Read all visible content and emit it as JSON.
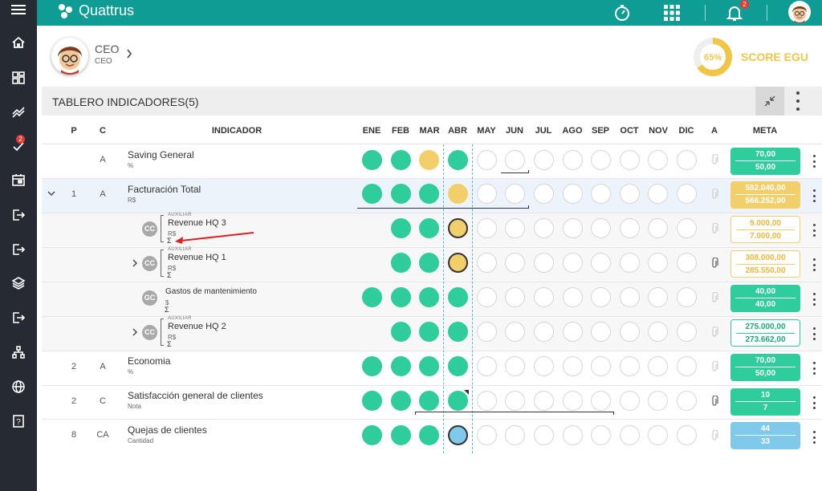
{
  "app": {
    "brand": "Quattrus",
    "bell_count": "2",
    "rail_badge": "2"
  },
  "profile": {
    "name": "CEO",
    "role": "CEO"
  },
  "score": {
    "percent_label": "65%",
    "percent": 65,
    "label": "SCORE EGU"
  },
  "table": {
    "title": "TABLERO INDICADORES(5)"
  },
  "columns": {
    "p": "P",
    "c": "C",
    "indicador": "INDICADOR",
    "a": "A",
    "meta": "META",
    "months": [
      "ENE",
      "FEB",
      "MAR",
      "ABR",
      "MAY",
      "JUN",
      "JUL",
      "AGO",
      "SEP",
      "OCT",
      "NOV",
      "DIC"
    ]
  },
  "rows": [
    {
      "p": "",
      "c": "A",
      "name": "Saving General",
      "unit": "%",
      "meta1": "70,00",
      "meta2": "50,00"
    },
    {
      "p": "1",
      "c": "A",
      "name": "Facturación Total",
      "unit": "R$",
      "meta1": "592.040,00",
      "meta2": "566.252,00"
    },
    {
      "badge": "CC",
      "aux": "AUXILIAR",
      "name": "Revenue HQ 3",
      "unit": "R$",
      "sigma": "Σ",
      "meta1": "9.000,00",
      "meta2": "7.000,00"
    },
    {
      "badge": "CC",
      "aux": "AUXILIAR",
      "name": "Revenue HQ 1",
      "unit": "R$",
      "sigma": "Σ",
      "meta1": "308.000,00",
      "meta2": "285.550,00"
    },
    {
      "badge": "GC",
      "aux": "",
      "name": "Gastos de mantenimiento",
      "unit": "$",
      "sigma": "Σ",
      "meta1": "40,00",
      "meta2": "40,00"
    },
    {
      "badge": "CC",
      "aux": "AUXILIAR",
      "name": "Revenue HQ 2",
      "unit": "R$",
      "sigma": "Σ",
      "meta1": "275.000,00",
      "meta2": "273.662,00"
    },
    {
      "p": "2",
      "c": "A",
      "name": "Economia",
      "unit": "%",
      "meta1": "70,00",
      "meta2": "50,00"
    },
    {
      "p": "2",
      "c": "C",
      "name": "Satisfacción general de clientes",
      "unit": "Nota",
      "meta1": "10",
      "meta2": "7"
    },
    {
      "p": "8",
      "c": "CA",
      "name": "Quejas de clientes",
      "unit": "Cantidad",
      "meta1": "44",
      "meta2": "33"
    }
  ],
  "status_colors": {
    "green": "#2fcc9c",
    "yellow": "#f2cf6b",
    "blue": "#7fc9ea",
    "teal_bar": "#0e9c95"
  }
}
